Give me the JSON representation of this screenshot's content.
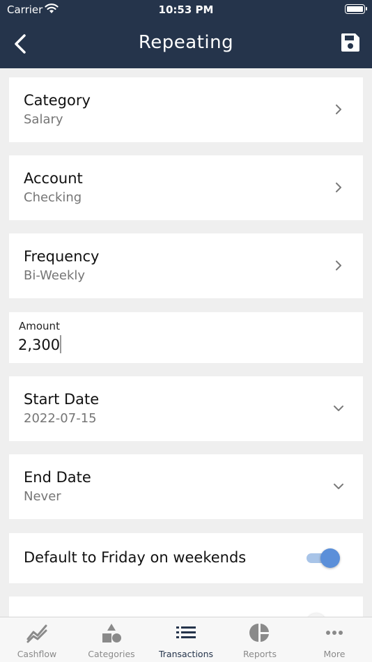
{
  "status_bar": {
    "carrier": "Carrier",
    "time": "10:53 PM"
  },
  "header": {
    "title": "Repeating"
  },
  "fields": {
    "category": {
      "label": "Category",
      "value": "Salary"
    },
    "account": {
      "label": "Account",
      "value": "Checking"
    },
    "frequency": {
      "label": "Frequency",
      "value": "Bi-Weekly"
    },
    "amount": {
      "label": "Amount",
      "value": "2,300"
    },
    "start_date": {
      "label": "Start Date",
      "value": "2022-07-15"
    },
    "end_date": {
      "label": "End Date",
      "value": "Never"
    },
    "default_friday": {
      "label": "Default to Friday on weekends",
      "enabled": true
    },
    "next_toggle": {
      "enabled": false
    }
  },
  "tabs": [
    {
      "label": "Cashflow",
      "icon": "chart-line-icon"
    },
    {
      "label": "Categories",
      "icon": "shapes-icon"
    },
    {
      "label": "Transactions",
      "icon": "list-icon",
      "active": true
    },
    {
      "label": "Reports",
      "icon": "pie-chart-icon"
    },
    {
      "label": "More",
      "icon": "more-dots-icon"
    }
  ],
  "colors": {
    "header_bg": "#25344b",
    "accent": "#5b8fd9",
    "active_tab": "#25344b",
    "inactive_tab": "#8a8a8a"
  }
}
